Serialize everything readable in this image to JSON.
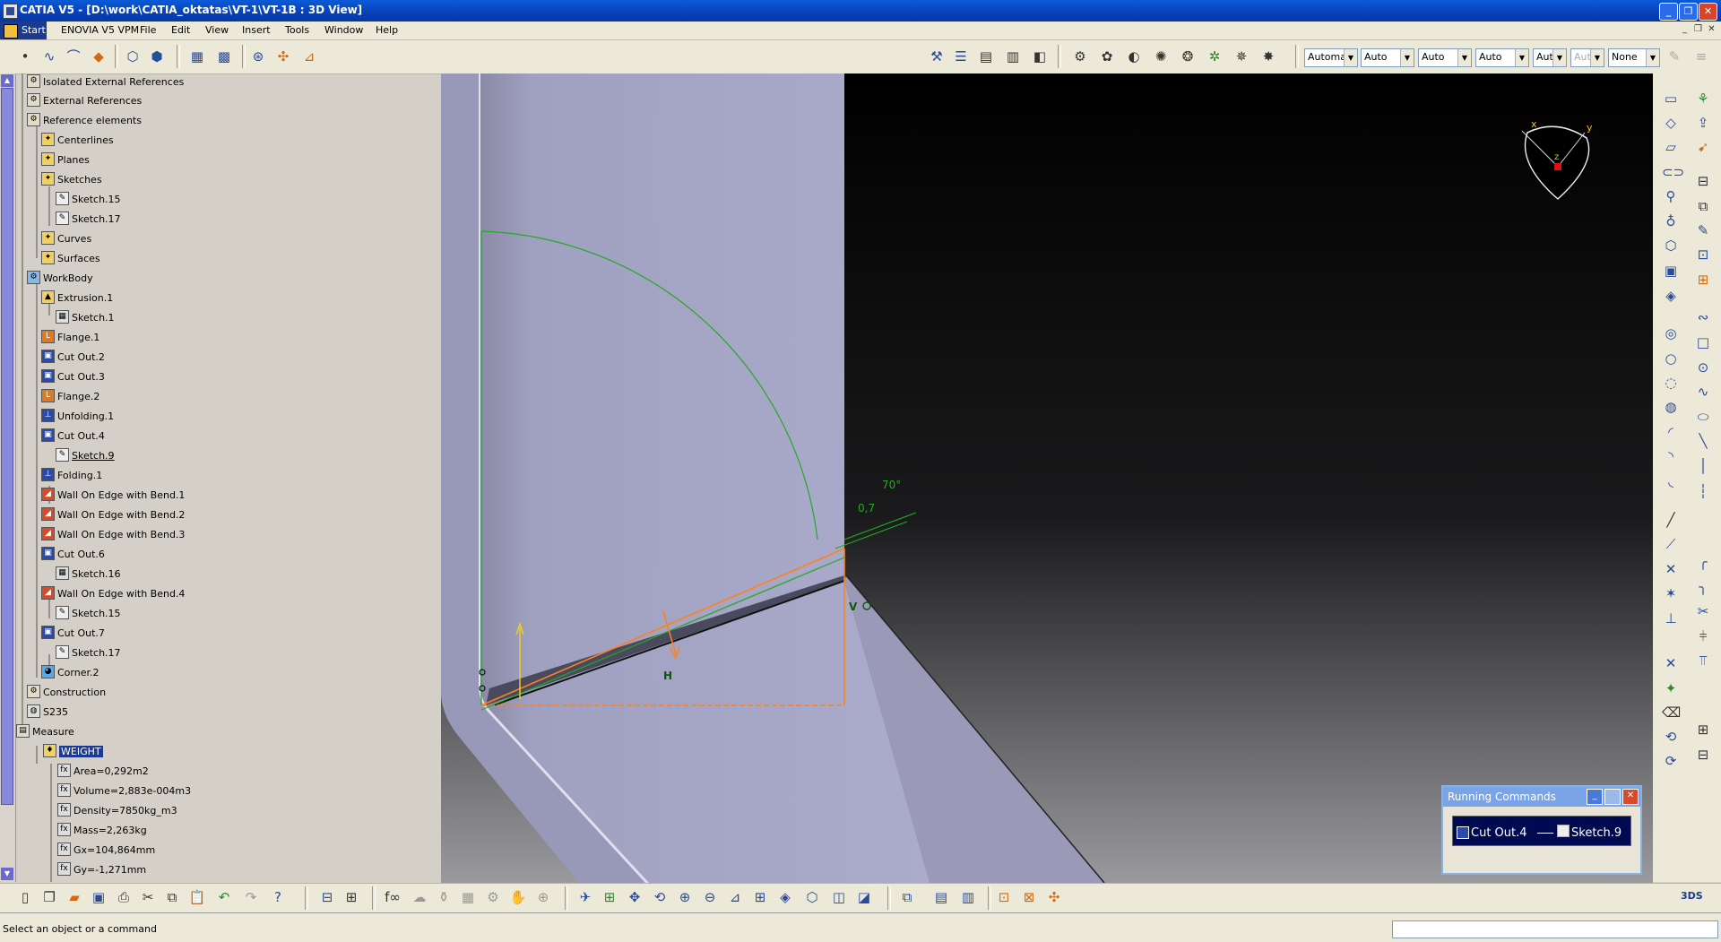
{
  "window": {
    "title": "CATIA V5 - [D:\\work\\CATIA_oktatas\\VT-1\\VT-1B : 3D View]",
    "controls": [
      "_",
      "❐",
      "✕"
    ]
  },
  "menu": {
    "items": [
      "Start",
      "ENOVIA V5 VPM",
      "File",
      "Edit",
      "View",
      "Insert",
      "Tools",
      "Window",
      "Help"
    ]
  },
  "toolbar_top": {
    "combos": [
      "Automa",
      "Auto",
      "Auto",
      "Auto",
      "Aut",
      "Aut",
      "None"
    ]
  },
  "tree": {
    "nodes": [
      {
        "label": "Isolated External References",
        "icon": "folder-icon"
      },
      {
        "label": "External References",
        "icon": "folder-icon"
      },
      {
        "label": "Reference elements",
        "icon": "folder-icon"
      },
      {
        "label": "Centerlines",
        "icon": "feature-icon"
      },
      {
        "label": "Planes",
        "icon": "feature-icon"
      },
      {
        "label": "Sketches",
        "icon": "feature-icon"
      },
      {
        "label": "Sketch.15",
        "icon": "sketch-icon"
      },
      {
        "label": "Sketch.17",
        "icon": "sketch-icon"
      },
      {
        "label": "Curves",
        "icon": "feature-icon"
      },
      {
        "label": "Surfaces",
        "icon": "feature-icon"
      },
      {
        "label": "WorkBody",
        "icon": "body-icon"
      },
      {
        "label": "Extrusion.1",
        "icon": "extrusion-icon"
      },
      {
        "label": "Sketch.1",
        "icon": "sketch-icon"
      },
      {
        "label": "Flange.1",
        "icon": "flange-icon"
      },
      {
        "label": "Cut Out.2",
        "icon": "cutout-icon"
      },
      {
        "label": "Cut Out.3",
        "icon": "cutout-icon"
      },
      {
        "label": "Flange.2",
        "icon": "flange-icon"
      },
      {
        "label": "Unfolding.1",
        "icon": "unfolding-icon"
      },
      {
        "label": "Cut Out.4",
        "icon": "cutout-icon"
      },
      {
        "label": "Sketch.9",
        "icon": "sketch-icon"
      },
      {
        "label": "Folding.1",
        "icon": "folding-icon"
      },
      {
        "label": "Wall On Edge with Bend.1",
        "icon": "wall-icon"
      },
      {
        "label": "Wall On Edge with Bend.2",
        "icon": "wall-icon"
      },
      {
        "label": "Wall On Edge with Bend.3",
        "icon": "wall-icon"
      },
      {
        "label": "Cut Out.6",
        "icon": "cutout-icon"
      },
      {
        "label": "Sketch.16",
        "icon": "sketch-icon"
      },
      {
        "label": "Wall On Edge with Bend.4",
        "icon": "wall-icon"
      },
      {
        "label": "Sketch.15",
        "icon": "sketch-icon"
      },
      {
        "label": "Cut Out.7",
        "icon": "cutout-icon"
      },
      {
        "label": "Sketch.17",
        "icon": "sketch-icon"
      },
      {
        "label": "Corner.2",
        "icon": "corner-icon"
      },
      {
        "label": "Construction",
        "icon": "folder-icon"
      },
      {
        "label": "S235",
        "icon": "material-icon"
      },
      {
        "label": "Measure",
        "icon": "measure-icon"
      },
      {
        "label": "WEIGHT",
        "icon": "weight-icon"
      },
      {
        "label": "Area=0,292m2",
        "icon": "parameter-icon"
      },
      {
        "label": "Volume=2,883e-004m3",
        "icon": "parameter-icon"
      },
      {
        "label": "Density=7850kg_m3",
        "icon": "parameter-icon"
      },
      {
        "label": "Mass=2,263kg",
        "icon": "parameter-icon"
      },
      {
        "label": "Gx=104,864mm",
        "icon": "parameter-icon"
      },
      {
        "label": "Gy=-1,271mm",
        "icon": "parameter-icon"
      }
    ]
  },
  "viewport": {
    "dimension_angle": "70°",
    "dimension_offset": "0,7",
    "constraint_h": "H",
    "constraint_v": "V",
    "compass_x": "x",
    "compass_y": "y",
    "compass_z": "z"
  },
  "running_commands": {
    "title": "Running Commands",
    "command": "Cut Out.4",
    "subcommand": "Sketch.9"
  },
  "status": {
    "text": "Select an object or a command"
  },
  "colors": {
    "titlebar": "#0840b8",
    "viewport_part": "#a8a8c8",
    "sketch_green": "#22aa22",
    "highlight_orange": "#ff8020"
  }
}
